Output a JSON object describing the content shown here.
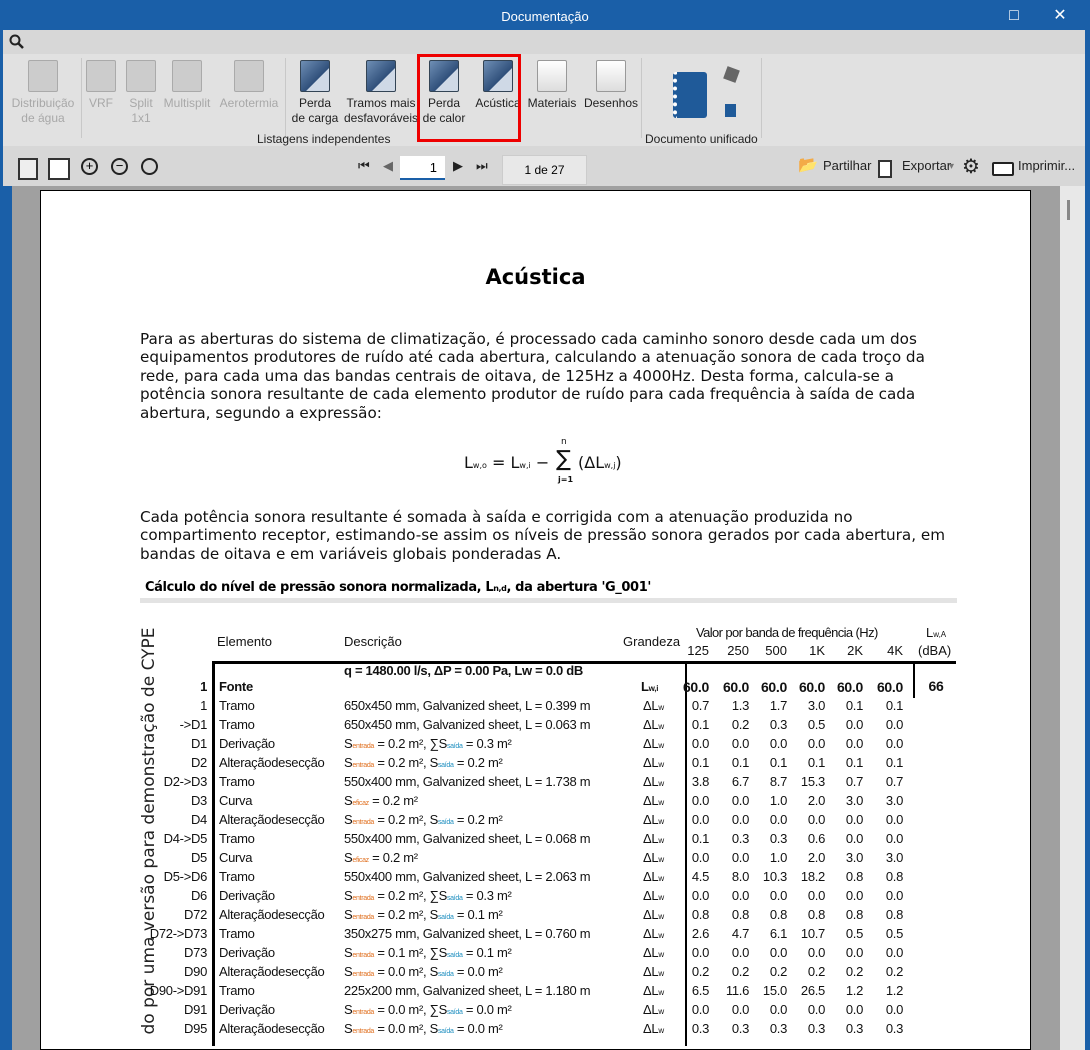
{
  "window": {
    "title": "Documentação",
    "maximize_icon": "□",
    "close_icon": "✕"
  },
  "ribbon": {
    "buttons": [
      {
        "label1": "Distribuição",
        "label2": "de água",
        "enabled": false,
        "icon": "document-icon"
      },
      {
        "label1": "VRF",
        "label2": "",
        "enabled": false,
        "icon": "vrf-icon"
      },
      {
        "label1": "Split",
        "label2": "1x1",
        "enabled": false,
        "icon": "split-icon"
      },
      {
        "label1": "Multisplit",
        "label2": "",
        "enabled": false,
        "icon": "multisplit-icon"
      },
      {
        "label1": "Aerotermia",
        "label2": "",
        "enabled": false,
        "icon": "aerotermia-icon"
      },
      {
        "label1": "Perda",
        "label2": "de carga",
        "enabled": true,
        "icon": "duct-icon"
      },
      {
        "label1": "Tramos mais",
        "label2": "desfavoráveis",
        "enabled": true,
        "icon": "duct-icon"
      },
      {
        "label1": "Perda",
        "label2": "de calor",
        "enabled": true,
        "icon": "duct-icon"
      },
      {
        "label1": "Acústica",
        "label2": "",
        "enabled": true,
        "icon": "duct-icon"
      },
      {
        "label1": "Materiais",
        "label2": "",
        "enabled": true,
        "icon": "materials-icon"
      },
      {
        "label1": "Desenhos",
        "label2": "",
        "enabled": true,
        "icon": "drawings-icon"
      }
    ],
    "group_listagens": "Listagens independentes",
    "group_documento": "Documento unificado"
  },
  "toolbar": {
    "page_value": "1",
    "page_count": "1 de 27",
    "share": "Partilhar",
    "export": "Exportar",
    "export_caret": "▾",
    "print": "Imprimir..."
  },
  "document": {
    "title": "Acústica",
    "para1": "Para as aberturas do sistema de climatização, é processado cada caminho sonoro desde cada um dos equipamentos produtores de ruído até cada abertura, calculando a atenuação sonora de cada troço da rede, para cada uma das bandas centrais de oitava, de 125Hz a 4000Hz. Desta forma, calcula-se a potência sonora resultante de cada elemento produtor de ruído para cada frequência à saída de cada abertura, segundo a expressão:",
    "formula": {
      "lhs": "L",
      "lhs_sub": "w,o",
      "eq": "= L",
      "rhs_sub": "w,i",
      "minus": "−",
      "sigma": "∑",
      "upper": "n",
      "lower": "j=1",
      "term": "(ΔL",
      "term_sub": "w,j",
      "close": ")"
    },
    "para2": "Cada potência sonora resultante é somada à saída e corrigida com a atenuação produzida no compartimento receptor, estimando-se assim os níveis de pressão sonora gerados por cada abertura, em bandas de oitava e em variáveis globais ponderadas A.",
    "watermark": "do por uma versão para demonstração de CYPE"
  },
  "table": {
    "title": "Cálculo do nível de pressão sonora normalizada, L",
    "title_sub": "n,d",
    "title_end": ", da abertura 'G_001'",
    "headers": {
      "elemento": "Elemento",
      "descricao": "Descrição",
      "grandeza": "Grandeza",
      "bands": "Valor por banda de frequência (Hz)",
      "lwa": "L",
      "lwa_sub": "w,A",
      "lwa_unit": "(dBA)"
    },
    "freqs": [
      "125",
      "250",
      "500",
      "1K",
      "2K",
      "4K"
    ],
    "source": {
      "id": "1",
      "elem": "Fonte",
      "desc": "q = 1480.00 l/s, ΔP = 0.00 Pa, Lw = 0.0 dB",
      "g": "L",
      "gsub": "w,i",
      "vals": [
        "60.0",
        "60.0",
        "60.0",
        "60.0",
        "60.0",
        "60.0"
      ],
      "lwa": "66"
    },
    "rows": [
      {
        "id": "1",
        "elem": "Tramo",
        "desc": [
          [
            "t",
            "650x450 mm, Galvanized sheet, L = 0.399 m"
          ]
        ],
        "vals": [
          "0.7",
          "1.3",
          "1.7",
          "3.0",
          "0.1",
          "0.1"
        ]
      },
      {
        "id": "->D1",
        "elem": "Tramo",
        "desc": [
          [
            "t",
            "650x450 mm, Galvanized sheet, L = 0.063 m"
          ]
        ],
        "vals": [
          "0.1",
          "0.2",
          "0.3",
          "0.5",
          "0.0",
          "0.0"
        ]
      },
      {
        "id": "D1",
        "elem": "Derivação",
        "desc": [
          [
            "t",
            "S"
          ],
          [
            "o",
            "entrada"
          ],
          [
            "t",
            " = 0.2 m², ∑S"
          ],
          [
            "b",
            "saída"
          ],
          [
            "t",
            " = 0.3 m²"
          ]
        ],
        "vals": [
          "0.0",
          "0.0",
          "0.0",
          "0.0",
          "0.0",
          "0.0"
        ]
      },
      {
        "id": "D2",
        "elem": "Alteraçãodesecção",
        "desc": [
          [
            "t",
            "S"
          ],
          [
            "o",
            "entrada"
          ],
          [
            "t",
            " = 0.2 m², S"
          ],
          [
            "b",
            "saída"
          ],
          [
            "t",
            " = 0.2 m²"
          ]
        ],
        "vals": [
          "0.1",
          "0.1",
          "0.1",
          "0.1",
          "0.1",
          "0.1"
        ]
      },
      {
        "id": "D2->D3",
        "elem": "Tramo",
        "desc": [
          [
            "t",
            "550x400 mm, Galvanized sheet, L = 1.738 m"
          ]
        ],
        "vals": [
          "3.8",
          "6.7",
          "8.7",
          "15.3",
          "0.7",
          "0.7"
        ]
      },
      {
        "id": "D3",
        "elem": "Curva",
        "desc": [
          [
            "t",
            "S"
          ],
          [
            "o",
            "eficaz"
          ],
          [
            "t",
            " = 0.2 m²"
          ]
        ],
        "vals": [
          "0.0",
          "0.0",
          "1.0",
          "2.0",
          "3.0",
          "3.0"
        ]
      },
      {
        "id": "D4",
        "elem": "Alteraçãodesecção",
        "desc": [
          [
            "t",
            "S"
          ],
          [
            "o",
            "entrada"
          ],
          [
            "t",
            " = 0.2 m², S"
          ],
          [
            "b",
            "saída"
          ],
          [
            "t",
            " = 0.2 m²"
          ]
        ],
        "vals": [
          "0.0",
          "0.0",
          "0.0",
          "0.0",
          "0.0",
          "0.0"
        ]
      },
      {
        "id": "D4->D5",
        "elem": "Tramo",
        "desc": [
          [
            "t",
            "550x400 mm, Galvanized sheet, L = 0.068 m"
          ]
        ],
        "vals": [
          "0.1",
          "0.3",
          "0.3",
          "0.6",
          "0.0",
          "0.0"
        ]
      },
      {
        "id": "D5",
        "elem": "Curva",
        "desc": [
          [
            "t",
            "S"
          ],
          [
            "o",
            "eficaz"
          ],
          [
            "t",
            " = 0.2 m²"
          ]
        ],
        "vals": [
          "0.0",
          "0.0",
          "1.0",
          "2.0",
          "3.0",
          "3.0"
        ]
      },
      {
        "id": "D5->D6",
        "elem": "Tramo",
        "desc": [
          [
            "t",
            "550x400 mm, Galvanized sheet, L = 2.063 m"
          ]
        ],
        "vals": [
          "4.5",
          "8.0",
          "10.3",
          "18.2",
          "0.8",
          "0.8"
        ]
      },
      {
        "id": "D6",
        "elem": "Derivação",
        "desc": [
          [
            "t",
            "S"
          ],
          [
            "o",
            "entrada"
          ],
          [
            "t",
            " = 0.2 m², ∑S"
          ],
          [
            "b",
            "saída"
          ],
          [
            "t",
            " = 0.3 m²"
          ]
        ],
        "vals": [
          "0.0",
          "0.0",
          "0.0",
          "0.0",
          "0.0",
          "0.0"
        ]
      },
      {
        "id": "D72",
        "elem": "Alteraçãodesecção",
        "desc": [
          [
            "t",
            "S"
          ],
          [
            "o",
            "entrada"
          ],
          [
            "t",
            " = 0.2 m², S"
          ],
          [
            "b",
            "saída"
          ],
          [
            "t",
            " = 0.1 m²"
          ]
        ],
        "vals": [
          "0.8",
          "0.8",
          "0.8",
          "0.8",
          "0.8",
          "0.8"
        ]
      },
      {
        "id": "D72->D73",
        "elem": "Tramo",
        "desc": [
          [
            "t",
            "350x275 mm, Galvanized sheet, L = 0.760 m"
          ]
        ],
        "vals": [
          "2.6",
          "4.7",
          "6.1",
          "10.7",
          "0.5",
          "0.5"
        ]
      },
      {
        "id": "D73",
        "elem": "Derivação",
        "desc": [
          [
            "t",
            "S"
          ],
          [
            "o",
            "entrada"
          ],
          [
            "t",
            " = 0.1 m², ∑S"
          ],
          [
            "b",
            "saída"
          ],
          [
            "t",
            " = 0.1 m²"
          ]
        ],
        "vals": [
          "0.0",
          "0.0",
          "0.0",
          "0.0",
          "0.0",
          "0.0"
        ]
      },
      {
        "id": "D90",
        "elem": "Alteraçãodesecção",
        "desc": [
          [
            "t",
            "S"
          ],
          [
            "o",
            "entrada"
          ],
          [
            "t",
            " = 0.0 m², S"
          ],
          [
            "b",
            "saída"
          ],
          [
            "t",
            " = 0.0 m²"
          ]
        ],
        "vals": [
          "0.2",
          "0.2",
          "0.2",
          "0.2",
          "0.2",
          "0.2"
        ]
      },
      {
        "id": "D90->D91",
        "elem": "Tramo",
        "desc": [
          [
            "t",
            "225x200 mm, Galvanized sheet, L = 1.180 m"
          ]
        ],
        "vals": [
          "6.5",
          "11.6",
          "15.0",
          "26.5",
          "1.2",
          "1.2"
        ]
      },
      {
        "id": "D91",
        "elem": "Derivação",
        "desc": [
          [
            "t",
            "S"
          ],
          [
            "o",
            "entrada"
          ],
          [
            "t",
            " = 0.0 m², ∑S"
          ],
          [
            "b",
            "saída"
          ],
          [
            "t",
            " = 0.0 m²"
          ]
        ],
        "vals": [
          "0.0",
          "0.0",
          "0.0",
          "0.0",
          "0.0",
          "0.0"
        ]
      },
      {
        "id": "D95",
        "elem": "Alteraçãodesecção",
        "desc": [
          [
            "t",
            "S"
          ],
          [
            "o",
            "entrada"
          ],
          [
            "t",
            " = 0.0 m², S"
          ],
          [
            "b",
            "saída"
          ],
          [
            "t",
            " = 0.0 m²"
          ]
        ],
        "vals": [
          "0.3",
          "0.3",
          "0.3",
          "0.3",
          "0.3",
          "0.3"
        ]
      }
    ],
    "row_g": "ΔL",
    "row_gsub": "w"
  }
}
